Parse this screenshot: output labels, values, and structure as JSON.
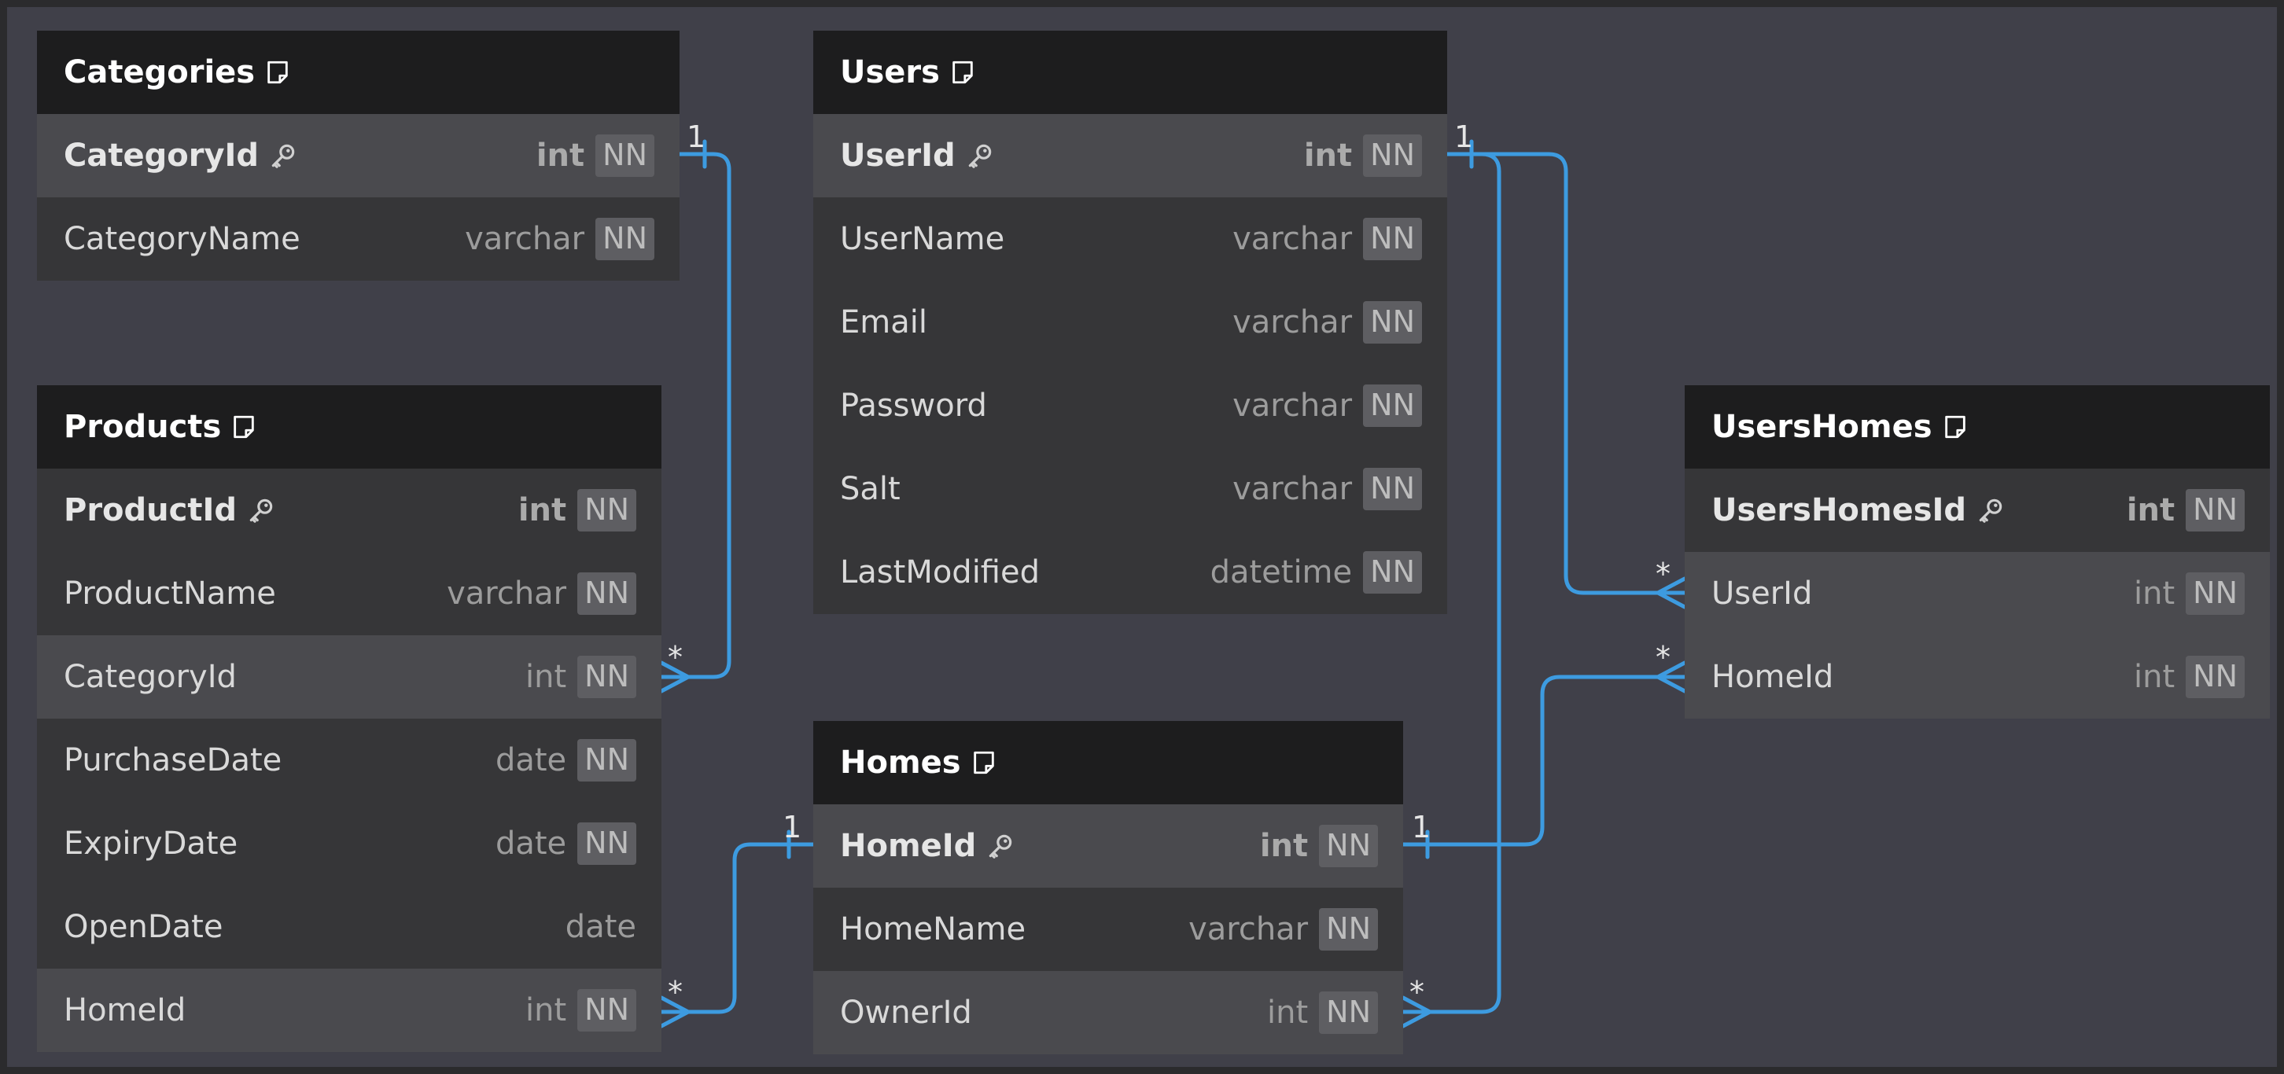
{
  "tables": {
    "categories": {
      "name": "Categories",
      "columns": [
        {
          "name": "CategoryId",
          "type": "int",
          "constraint": "NN"
        },
        {
          "name": "CategoryName",
          "type": "varchar",
          "constraint": "NN"
        }
      ]
    },
    "products": {
      "name": "Products",
      "columns": [
        {
          "name": "ProductId",
          "type": "int",
          "constraint": "NN"
        },
        {
          "name": "ProductName",
          "type": "varchar",
          "constraint": "NN"
        },
        {
          "name": "CategoryId",
          "type": "int",
          "constraint": "NN"
        },
        {
          "name": "PurchaseDate",
          "type": "date",
          "constraint": "NN"
        },
        {
          "name": "ExpiryDate",
          "type": "date",
          "constraint": "NN"
        },
        {
          "name": "OpenDate",
          "type": "date"
        },
        {
          "name": "HomeId",
          "type": "int",
          "constraint": "NN"
        }
      ]
    },
    "users": {
      "name": "Users",
      "columns": [
        {
          "name": "UserId",
          "type": "int",
          "constraint": "NN"
        },
        {
          "name": "UserName",
          "type": "varchar",
          "constraint": "NN"
        },
        {
          "name": "Email",
          "type": "varchar",
          "constraint": "NN"
        },
        {
          "name": "Password",
          "type": "varchar",
          "constraint": "NN"
        },
        {
          "name": "Salt",
          "type": "varchar",
          "constraint": "NN"
        },
        {
          "name": "LastModified",
          "type": "datetime",
          "constraint": "NN"
        }
      ]
    },
    "homes": {
      "name": "Homes",
      "columns": [
        {
          "name": "HomeId",
          "type": "int",
          "constraint": "NN"
        },
        {
          "name": "HomeName",
          "type": "varchar",
          "constraint": "NN"
        },
        {
          "name": "OwnerId",
          "type": "int",
          "constraint": "NN"
        }
      ]
    },
    "usershomes": {
      "name": "UsersHomes",
      "columns": [
        {
          "name": "UsersHomesId",
          "type": "int",
          "constraint": "NN"
        },
        {
          "name": "UserId",
          "type": "int",
          "constraint": "NN"
        },
        {
          "name": "HomeId",
          "type": "int",
          "constraint": "NN"
        }
      ]
    }
  },
  "relations": [
    {
      "from": "Categories.CategoryId",
      "to": "Products.CategoryId",
      "from_card": "1",
      "to_card": "*"
    },
    {
      "from": "Homes.HomeId",
      "to": "Products.HomeId",
      "from_card": "1",
      "to_card": "*"
    },
    {
      "from": "Users.UserId",
      "to": "UsersHomes.UserId",
      "from_card": "1",
      "to_card": "*"
    },
    {
      "from": "Users.UserId",
      "to": "Homes.OwnerId",
      "from_card": "1",
      "to_card": "*"
    },
    {
      "from": "Homes.HomeId",
      "to": "UsersHomes.HomeId",
      "from_card": "1",
      "to_card": "*"
    }
  ],
  "colors": {
    "canvas": "#404049",
    "header": "#1d1d1e",
    "row": "#363638",
    "row_highlight": "#4a4a4e",
    "relation": "#3d9be0"
  },
  "icons": {
    "table": "note-icon",
    "primary_key": "key-icon"
  }
}
